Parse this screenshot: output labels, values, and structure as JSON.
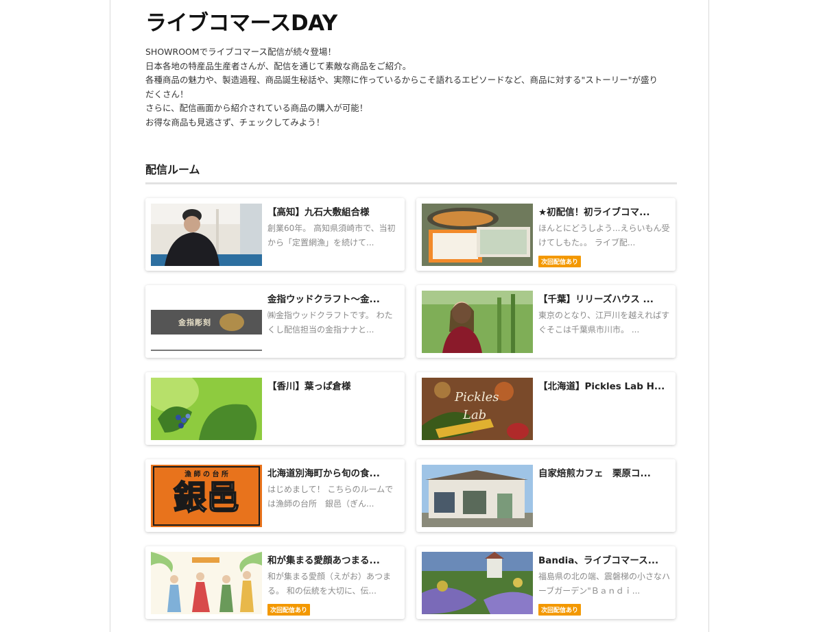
{
  "page": {
    "title": "ライブコマースDAY",
    "intro": [
      "SHOWROOMでライブコマース配信が続々登場！",
      "日本各地の特産品生産者さんが、配信を通じて素敵な商品をご紹介。",
      "各種商品の魅力や、製造過程、商品誕生秘話や、実際に作っているからこそ語れるエピソードなど、商品に対する\"ストーリー\"が盛りだくさん！",
      "さらに、配信画面から紹介されている商品の購入が可能！",
      "お得な商品も見逃さず、チェックしてみよう！"
    ]
  },
  "section": {
    "title": "配信ルーム"
  },
  "rooms": [
    {
      "title": "【高知】九石大敷組合様",
      "desc": "創業60年。 高知県須崎市で、当初から「定置網漁」を続けて...",
      "badge": ""
    },
    {
      "title": "★初配信！初ライブコマ...",
      "desc": "ほんとにどうしよう...えらいもん受けてしもた。。 ライブ配...",
      "badge": "次回配信あり"
    },
    {
      "title": "金指ウッドクラフト〜金...",
      "desc": "㈱金指ウッドクラフトです。 わたくし配信担当の金指ナナと...",
      "badge": ""
    },
    {
      "title": "【千葉】リリーズハウス ...",
      "desc": "東京のとなり、江戸川を越えればすぐそこは千葉県市川市。 ...",
      "badge": ""
    },
    {
      "title": "【香川】葉っぱ倉様",
      "desc": "",
      "badge": ""
    },
    {
      "title": "【北海道】Pickles Lab H...",
      "desc": "",
      "badge": ""
    },
    {
      "title": "北海道別海町から旬の食...",
      "desc": "はじめまして！ こちらのルームでは漁師の台所　銀邑（ぎん...",
      "badge": ""
    },
    {
      "title": "自家焙煎カフェ　栗原コ...",
      "desc": "",
      "badge": ""
    },
    {
      "title": "和が集まる愛顔あつまる...",
      "desc": "和が集まる愛顔（えがお）あつまる。 和の伝統を大切に、伝...",
      "badge": "次回配信あり"
    },
    {
      "title": "Bandia、ライブコマース...",
      "desc": "福島県の北の端、震磐梯の小さなハーブガーデン\"Ｂａｎｄｉ...",
      "badge": "次回配信あり"
    }
  ],
  "thumbs": {
    "kanazashi_logo": "金指彫刻",
    "pickles_text_1": "Pickles",
    "pickles_text_2": "Lab",
    "ginyu_top": "漁 師 の 台 所",
    "ginyu_big": "銀邑"
  },
  "colors": {
    "badge": "#f39800"
  }
}
